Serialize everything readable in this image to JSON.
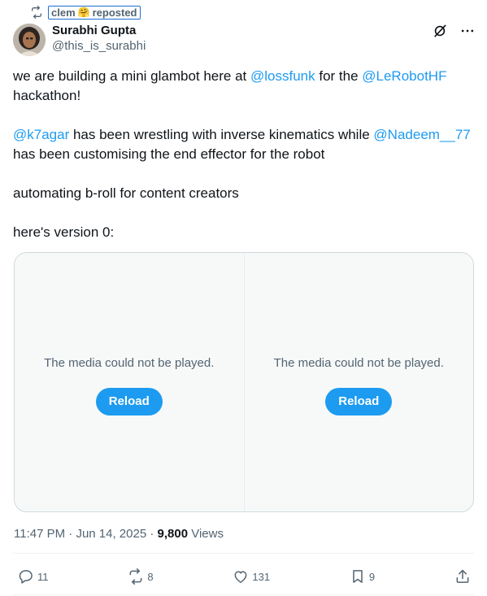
{
  "repost": {
    "icon": "repost-icon",
    "user": "clem",
    "emoji": "🤗",
    "label": "reposted"
  },
  "author": {
    "name": "Surabhi Gupta",
    "handle": "@this_is_surabhi",
    "avatar": "avatar-photo"
  },
  "top_icons": [
    "grok-icon",
    "more-icon"
  ],
  "tweet": {
    "p1": {
      "t1": "we are building a mini glambot here at ",
      "m1": "@lossfunk",
      "t2": " for the ",
      "m2": "@LeRobotHF",
      "t3": "hackathon!"
    },
    "p2": {
      "m1": "@k7agar",
      "t1": " has been wrestling with inverse kinematics while ",
      "m2": "@Nadeem__77",
      "t2": "has been customising the end effector for the robot"
    },
    "p3": "automating b-roll for content creators",
    "p4": "here's version 0:"
  },
  "media": [
    {
      "message": "The media could not be played.",
      "button": "Reload"
    },
    {
      "message": "The media could not be played.",
      "button": "Reload"
    }
  ],
  "meta": {
    "time": "11:47 PM",
    "sep1": " · ",
    "date": "Jun 14, 2025",
    "sep2": " · ",
    "views": "9,800",
    "views_label": " Views"
  },
  "actions": {
    "replies": "11",
    "reposts": "8",
    "likes": "131",
    "bookmarks": "9"
  },
  "colors": {
    "accent": "#1d9bf0",
    "muted": "#536471",
    "text": "#0f1419"
  }
}
